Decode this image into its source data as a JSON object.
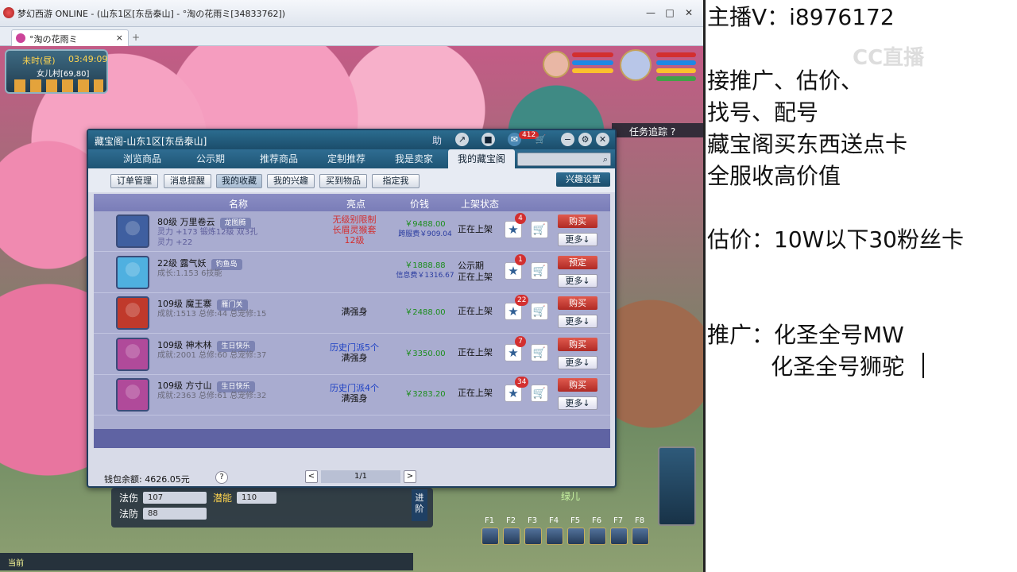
{
  "window": {
    "title": "梦幻西游 ONLINE - (山东1区[东岳泰山] - °淘の花雨ミ[34833762])",
    "tab_label": "°淘の花雨ミ",
    "tab_close": "×",
    "new_tab": "+"
  },
  "hud": {
    "time_label": "未时(昼)",
    "clock": "03:49:09",
    "location": "女儿村[69,80]",
    "task_tracking": "任务追踪",
    "npc_name": "绿儿",
    "current_channel": "当前",
    "advance": "进阶"
  },
  "stats": [
    {
      "label": "法伤",
      "value": "107"
    },
    {
      "label": "潜能",
      "value": "110"
    },
    {
      "label": "法防",
      "value": "88"
    }
  ],
  "hotkeys": [
    "F1",
    "F2",
    "F3",
    "F4",
    "F5",
    "F6",
    "F7",
    "F8"
  ],
  "dialog": {
    "title": "藏宝阁-山东1区[东岳泰山]",
    "help": "助",
    "mail_count": "412",
    "nav_tabs": [
      "浏览商品",
      "公示期",
      "推荐商品",
      "定制推荐",
      "我是卖家",
      "我的藏宝阁"
    ],
    "active_tab": 5,
    "sub_buttons": [
      "订单管理",
      "消息提醒",
      "我的收藏",
      "我的兴趣",
      "买到物品",
      "指定我"
    ],
    "active_sub": 2,
    "interest_button": "兴趣设置",
    "columns": [
      "名称",
      "亮点",
      "价钱",
      "上架状态"
    ],
    "rows": [
      {
        "name": "80级 万里卷云",
        "tag": "龙图腾",
        "detail": [
          "灵力 +173 锻炼12级 双3孔",
          "灵力 +22"
        ],
        "feature": [
          "无级别限制",
          "长眉灵猴套",
          "12级"
        ],
        "feature_colors": [
          "#d32f2f",
          "#d32f2f",
          "#d32f2f"
        ],
        "price": "￥9488.00",
        "price_sub": "跨服费￥909.04",
        "status": [
          "正在上架"
        ],
        "favorites": "4",
        "buy_label": "购买",
        "more_label": "更多↓",
        "avatar_color": "#3f5fa0"
      },
      {
        "name": "22级 露气妖",
        "tag": "钓鱼岛",
        "detail": [
          "成长:1.153 6技能"
        ],
        "feature": [],
        "feature_colors": [],
        "price": "￥1888.88",
        "price_sub": "信息费￥1316.67",
        "status": [
          "公示期",
          "正在上架"
        ],
        "favorites": "1",
        "buy_label": "预定",
        "more_label": "更多↓",
        "avatar_color": "#4fb0e0"
      },
      {
        "name": "109级 魔王寨",
        "tag": "雁门关",
        "detail": [
          "成就:1513 总修:44 总宠修:15"
        ],
        "feature": [
          "满强身"
        ],
        "feature_colors": [
          "#111111"
        ],
        "price": "￥2488.00",
        "price_sub": "",
        "status": [
          "正在上架"
        ],
        "favorites": "22",
        "buy_label": "购买",
        "more_label": "更多↓",
        "avatar_color": "#c0392b"
      },
      {
        "name": "109级 神木林",
        "tag": "生日快乐",
        "detail": [
          "成就:2001 总修:60 总宠修:37"
        ],
        "feature": [
          "历史门派5个",
          "满强身"
        ],
        "feature_colors": [
          "#1b3fc4",
          "#111111"
        ],
        "price": "￥3350.00",
        "price_sub": "",
        "status": [
          "正在上架"
        ],
        "favorites": "7",
        "buy_label": "购买",
        "more_label": "更多↓",
        "avatar_color": "#b04a9a"
      },
      {
        "name": "109级 方寸山",
        "tag": "生日快乐",
        "detail": [
          "成就:2363 总修:61 总宠修:32"
        ],
        "feature": [
          "历史门派4个",
          "满强身"
        ],
        "feature_colors": [
          "#1b3fc4",
          "#111111"
        ],
        "price": "￥3283.20",
        "price_sub": "",
        "status": [
          "正在上架"
        ],
        "favorites": "34",
        "buy_label": "购买",
        "more_label": "更多↓",
        "avatar_color": "#b04a9a"
      }
    ],
    "wallet_label": "钱包余额:",
    "wallet_value": "4626.05元",
    "help_q": "?",
    "page": "1/1",
    "prev": "<",
    "next": ">"
  },
  "stream_panel": {
    "lines": [
      "主播V：i8976172",
      "接推广、估价、",
      "   找号、配号",
      "藏宝阁买东西送点卡",
      "全服收高价值",
      "估价：10W以下30粉丝卡",
      "推广：化圣全号MW",
      "         化圣全号狮驼"
    ],
    "watermark": "CC直播"
  }
}
